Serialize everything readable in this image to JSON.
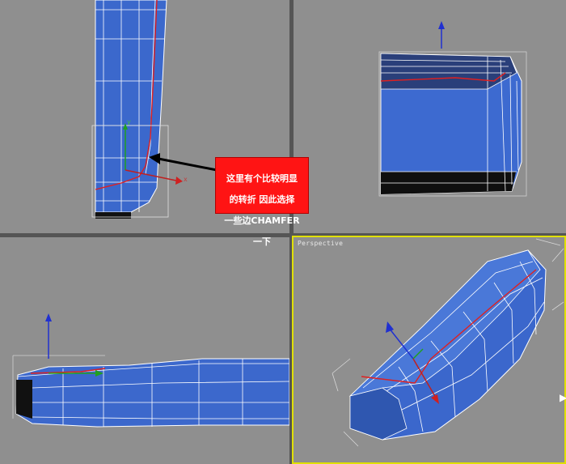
{
  "viewports": {
    "top": {
      "label": ""
    },
    "front": {
      "label": ""
    },
    "left": {
      "label": ""
    },
    "perspective": {
      "label": "Perspective"
    }
  },
  "gizmo": {
    "x_label": "x",
    "y_label": "y"
  },
  "callout": {
    "lines": [
      "这里有个比较明显",
      "的转折 因此选择",
      "一些边CHAMFER",
      "一下"
    ]
  },
  "colors": {
    "viewport_bg": "#8f8f8f",
    "mesh_fill": "#3a66c8",
    "wire": "#ffffff",
    "selected_edge": "#e02020",
    "active_border": "#e0e000",
    "callout_bg": "#ff1414"
  }
}
